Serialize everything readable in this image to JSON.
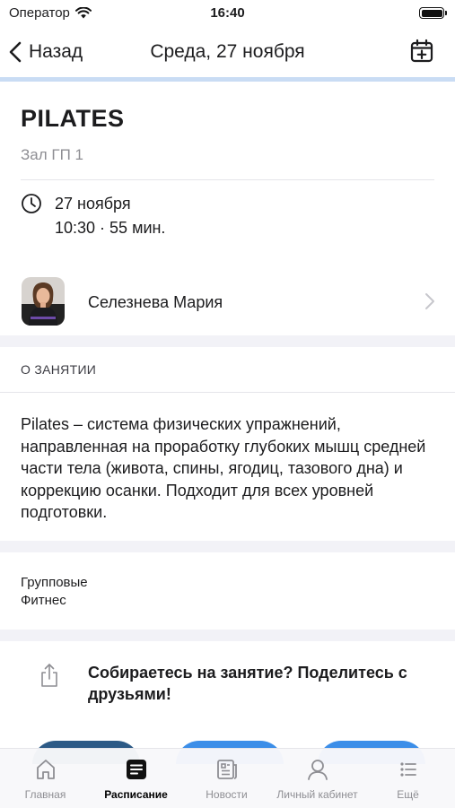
{
  "status_bar": {
    "carrier": "Оператор",
    "time": "16:40"
  },
  "nav": {
    "back_label": "Назад",
    "title": "Среда, 27 ноября"
  },
  "class": {
    "title": "PILATES",
    "hall": "Зал ГП 1",
    "date": "27 ноября",
    "time_duration": "10:30 · 55 мин."
  },
  "trainer": {
    "name": "Селезнева Мария"
  },
  "about": {
    "header": "О ЗАНЯТИИ",
    "description": "Pilates – система физических упражнений, направленная на проработку глубоких мышц средней части тела (живота, спины, ягодиц, тазового дна) и коррекцию осанки. Подходит для всех уровней подготовки."
  },
  "tags": [
    "Групповые",
    "Фитнес"
  ],
  "share": {
    "text": "Собираетесь на занятие? Поделитесь с друзьями!"
  },
  "tab_bar": {
    "items": [
      {
        "label": "Главная",
        "icon": "home-icon",
        "active": false
      },
      {
        "label": "Расписание",
        "icon": "schedule-icon",
        "active": true
      },
      {
        "label": "Новости",
        "icon": "news-icon",
        "active": false
      },
      {
        "label": "Личный кабинет",
        "icon": "profile-icon",
        "active": false
      },
      {
        "label": "Ещё",
        "icon": "more-icon",
        "active": false
      }
    ]
  },
  "colors": {
    "accent": "#3c8ee8",
    "accent_dark": "#2d5a86",
    "nav_accent": "#c9dcf4",
    "band": "#f2f2f7"
  }
}
